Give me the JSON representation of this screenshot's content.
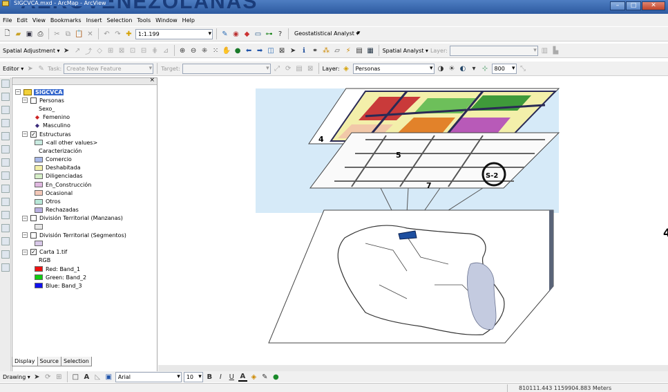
{
  "window": {
    "background_heading": "AEROVENEZOLANAS\"",
    "title": "SIGCVCA.mxd - ArcMap - ArcView",
    "controls": [
      "–",
      "□",
      "✕"
    ]
  },
  "menu": [
    "File",
    "Edit",
    "View",
    "Bookmarks",
    "Insert",
    "Selection",
    "Tools",
    "Window",
    "Help"
  ],
  "standard_toolbar": {
    "scale": "1:1.199",
    "geostatistical_label": "Geostatistical Analyst ▾"
  },
  "spatial_toolbar": {
    "spatial_adjustment_label": "Spatial Adjustment ▾",
    "spatial_analyst_label": "Spatial Analyst ▾",
    "layer_label": "Layer:"
  },
  "editor_toolbar": {
    "editor_label": "Editor ▾",
    "task_label": "Task:",
    "task_value": "Create New Feature",
    "target_label": "Target:",
    "layer_label": "Layer:",
    "layer_value": "Personas",
    "size_value": "800"
  },
  "toc": {
    "close_glyph": "×",
    "root": "SIGCVCA",
    "layers": [
      {
        "name": "Personas",
        "checked": false,
        "field": "Sexo_",
        "classes": [
          {
            "label": "Femenino",
            "color": "#cc2222",
            "symbol": "dot"
          },
          {
            "label": "Masculino",
            "color": "#3a2a7a",
            "symbol": "dot"
          }
        ]
      },
      {
        "name": "Estructuras",
        "checked": true,
        "first": {
          "label": "<all other values>",
          "color": "#c8eae0"
        },
        "field": "Caracterización",
        "classes": [
          {
            "label": "Comercio",
            "color": "#a8b8e8"
          },
          {
            "label": "Deshabitada",
            "color": "#f4f0a8"
          },
          {
            "label": "Diligenciadas",
            "color": "#d6efc8"
          },
          {
            "label": "En_Construcción",
            "color": "#e0b8e0"
          },
          {
            "label": "Ocasional",
            "color": "#f4c8b8"
          },
          {
            "label": "Otros",
            "color": "#b8e8d8"
          },
          {
            "label": "Rechazadas",
            "color": "#b8b0e0"
          }
        ]
      },
      {
        "name": "División Territorial (Manzanas)",
        "checked": false,
        "swatch": "#e8e8e8"
      },
      {
        "name": "División Territorial (Segmentos)",
        "checked": false,
        "swatch": "#d8c8e8"
      },
      {
        "name": "Carta 1.tif",
        "checked": true,
        "field": "RGB",
        "classes": [
          {
            "label": "Red:   Band_1",
            "color": "#ee1111"
          },
          {
            "label": "Green: Band_2",
            "color": "#11cc11"
          },
          {
            "label": "Blue:  Band_3",
            "color": "#1111ee"
          }
        ]
      }
    ],
    "tabs": [
      "Display",
      "Source",
      "Selection"
    ]
  },
  "drawing_toolbar": {
    "drawing_label": "Drawing ▾",
    "font": "Arial",
    "font_size": "10",
    "bold": "B",
    "italic": "I",
    "underline": "U",
    "font_color_glyph": "A"
  },
  "map": {
    "sheet_labels": [
      "4",
      "5",
      "7",
      "4"
    ],
    "zone_label": "S-2"
  },
  "status": {
    "coordinates": "810111.443  1159904.883 Meters"
  }
}
